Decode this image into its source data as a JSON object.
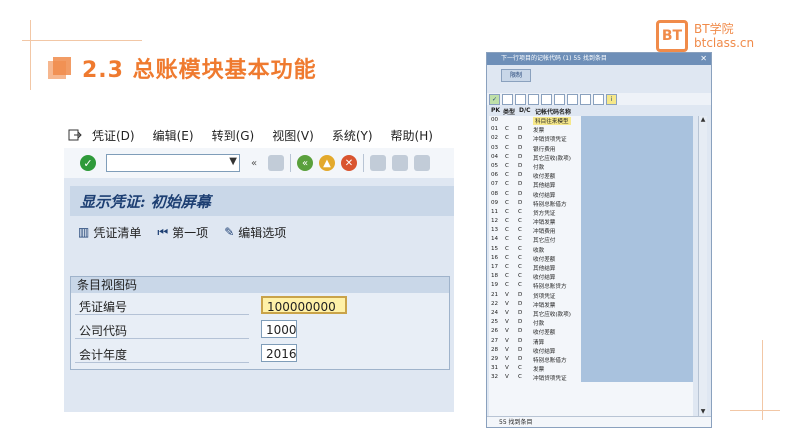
{
  "slide": {
    "title": "2.3 总账模块基本功能",
    "logo_mark": "BT",
    "logo_line1": "BT学院",
    "logo_line2": "btclass.cn"
  },
  "colors": {
    "accent": "#ef7a2f",
    "sap_bg": "#dfe7f2",
    "header": "#c9d7e8"
  },
  "sap": {
    "menu": [
      "凭证(D)",
      "编辑(E)",
      "转到(G)",
      "视图(V)",
      "系统(Y)",
      "帮助(H)"
    ],
    "screen_title": "显示凭证: 初始屏幕",
    "app_toolbar": [
      {
        "icon": "list-icon",
        "label": "凭证清单"
      },
      {
        "icon": "first-item-icon",
        "label": "第一项"
      },
      {
        "icon": "edit-pencil-icon",
        "label": "编辑选项"
      }
    ],
    "group_title": "条目视图码",
    "fields": [
      {
        "label": "凭证编号",
        "value": "100000000"
      },
      {
        "label": "公司代码",
        "value": "1000"
      },
      {
        "label": "会计年度",
        "value": "2016"
      }
    ]
  },
  "popup": {
    "title": "下一行项目的记帐代码 (1)  55 找到条目",
    "tab": "限制",
    "header": {
      "pk": "PK",
      "type": "类型",
      "dc": "D/C",
      "name": "记帐代码名称"
    },
    "rows": [
      [
        "00",
        "",
        "",
        "科目往来模型"
      ],
      [
        "01",
        "C",
        "D",
        "发票"
      ],
      [
        "02",
        "C",
        "D",
        "冲销贷项凭证"
      ],
      [
        "03",
        "C",
        "D",
        "银行费用"
      ],
      [
        "04",
        "C",
        "D",
        "其它应收(款项)"
      ],
      [
        "05",
        "C",
        "D",
        "付款"
      ],
      [
        "06",
        "C",
        "D",
        "收付差额"
      ],
      [
        "07",
        "C",
        "D",
        "其他结算"
      ],
      [
        "08",
        "C",
        "D",
        "收付结算"
      ],
      [
        "09",
        "C",
        "D",
        "特别总账借方"
      ],
      [
        "11",
        "C",
        "C",
        "贷方凭证"
      ],
      [
        "12",
        "C",
        "C",
        "冲销发票"
      ],
      [
        "13",
        "C",
        "C",
        "冲销费用"
      ],
      [
        "14",
        "C",
        "C",
        "其它应付"
      ],
      [
        "15",
        "C",
        "C",
        "收款"
      ],
      [
        "16",
        "C",
        "C",
        "收付差额"
      ],
      [
        "17",
        "C",
        "C",
        "其他结算"
      ],
      [
        "18",
        "C",
        "C",
        "收付结算"
      ],
      [
        "19",
        "C",
        "C",
        "特别总账贷方"
      ],
      [
        "21",
        "V",
        "D",
        "贷项凭证"
      ],
      [
        "22",
        "V",
        "D",
        "冲销发票"
      ],
      [
        "24",
        "V",
        "D",
        "其它应收(款项)"
      ],
      [
        "25",
        "V",
        "D",
        "付款"
      ],
      [
        "26",
        "V",
        "D",
        "收付差额"
      ],
      [
        "27",
        "V",
        "D",
        "清算"
      ],
      [
        "28",
        "V",
        "D",
        "收付结算"
      ],
      [
        "29",
        "V",
        "D",
        "特别总账借方"
      ],
      [
        "31",
        "V",
        "C",
        "发票"
      ],
      [
        "32",
        "V",
        "C",
        "冲销贷项凭证"
      ]
    ],
    "status": "55 找到条目"
  }
}
